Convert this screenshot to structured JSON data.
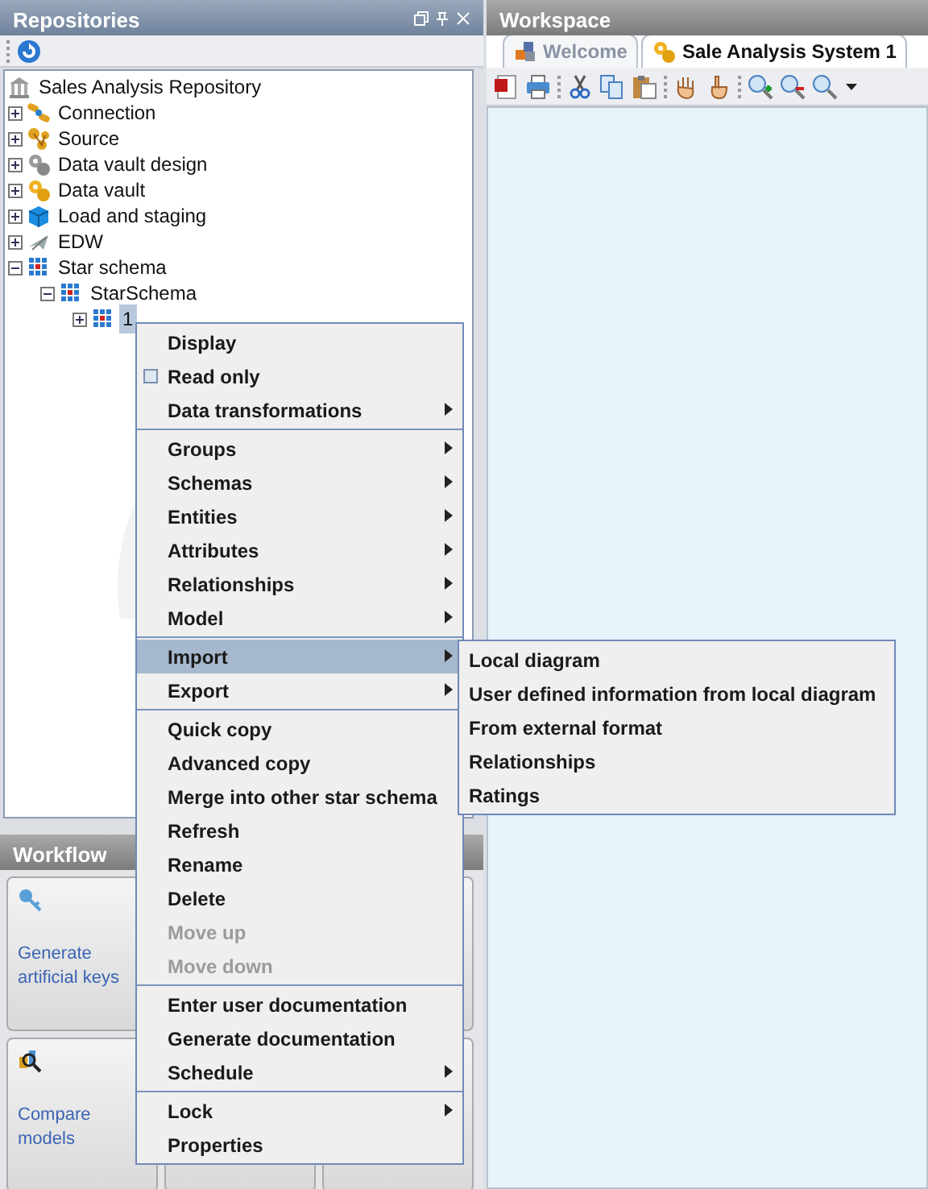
{
  "repositories": {
    "title": "Repositories",
    "tree": [
      {
        "label": "Sales Analysis Repository",
        "kind": "repository",
        "selected": false,
        "children": [
          {
            "label": "Connection",
            "kind": "connection",
            "expanded": false,
            "selected": false
          },
          {
            "label": "Source",
            "kind": "source",
            "expanded": false,
            "selected": false
          },
          {
            "label": "Data vault design",
            "kind": "gears-grey",
            "expanded": false,
            "selected": false
          },
          {
            "label": "Data vault",
            "kind": "gears",
            "expanded": false,
            "selected": false
          },
          {
            "label": "Load and staging",
            "kind": "cube",
            "expanded": false,
            "selected": false
          },
          {
            "label": "EDW",
            "kind": "plane",
            "expanded": false,
            "selected": false
          },
          {
            "label": "Star schema",
            "kind": "grid",
            "expanded": true,
            "selected": false,
            "children": [
              {
                "label": "StarSchema",
                "kind": "grid",
                "expanded": true,
                "selected": false,
                "children": [
                  {
                    "label": "1",
                    "kind": "grid",
                    "expanded": false,
                    "selected": true
                  }
                ]
              }
            ]
          }
        ]
      }
    ]
  },
  "workflow": {
    "title": "Workflow",
    "cards": [
      {
        "label": "Generate artificial keys",
        "kind": "key"
      },
      {
        "kind": "blank"
      },
      {
        "label": "Compare models",
        "kind": "compare"
      },
      {
        "kind": "blank"
      },
      {
        "kind": "blank"
      }
    ]
  },
  "workspace": {
    "title": "Workspace",
    "tabs": [
      {
        "label": "Welcome",
        "kind": "welcome",
        "selected": false
      },
      {
        "label": "Sale Analysis System 1",
        "kind": "gears",
        "selected": true
      }
    ],
    "toolbar": [
      {
        "items": [
          {
            "kind": "pdf"
          },
          {
            "kind": "print"
          }
        ]
      },
      {
        "items": [
          {
            "kind": "cut"
          },
          {
            "kind": "copy"
          },
          {
            "kind": "paste"
          }
        ]
      },
      {
        "items": [
          {
            "kind": "hand"
          },
          {
            "kind": "pointer"
          }
        ]
      },
      {
        "items": [
          {
            "kind": "zoom-in"
          },
          {
            "kind": "zoom-out"
          },
          {
            "kind": "zoom"
          },
          {
            "kind": "caret"
          }
        ]
      }
    ]
  },
  "context_menu": {
    "groups": [
      [
        {
          "label": "Display",
          "selected": false,
          "disabled": false,
          "submenu": false
        },
        {
          "label": "Read only",
          "kind": "checkbox",
          "checked": false,
          "selected": false,
          "disabled": false,
          "submenu": false
        },
        {
          "label": "Data transformations",
          "selected": false,
          "disabled": false,
          "submenu": true
        }
      ],
      [
        {
          "label": "Groups",
          "selected": false,
          "disabled": false,
          "submenu": true
        },
        {
          "label": "Schemas",
          "selected": false,
          "disabled": false,
          "submenu": true
        },
        {
          "label": "Entities",
          "selected": false,
          "disabled": false,
          "submenu": true
        },
        {
          "label": "Attributes",
          "selected": false,
          "disabled": false,
          "submenu": true
        },
        {
          "label": "Relationships",
          "selected": false,
          "disabled": false,
          "submenu": true
        },
        {
          "label": "Model",
          "selected": false,
          "disabled": false,
          "submenu": true
        }
      ],
      [
        {
          "label": "Import",
          "selected": true,
          "disabled": false,
          "submenu": true
        },
        {
          "label": "Export",
          "selected": false,
          "disabled": false,
          "submenu": true
        }
      ],
      [
        {
          "label": "Quick copy",
          "selected": false,
          "disabled": false,
          "submenu": false
        },
        {
          "label": "Advanced copy",
          "selected": false,
          "disabled": false,
          "submenu": false
        },
        {
          "label": "Merge into other star schema",
          "selected": false,
          "disabled": false,
          "submenu": false
        },
        {
          "label": "Refresh",
          "selected": false,
          "disabled": false,
          "submenu": false
        },
        {
          "label": "Rename",
          "selected": false,
          "disabled": false,
          "submenu": false
        },
        {
          "label": "Delete",
          "selected": false,
          "disabled": false,
          "submenu": false
        },
        {
          "label": "Move up",
          "selected": false,
          "disabled": true,
          "submenu": false
        },
        {
          "label": "Move down",
          "selected": false,
          "disabled": true,
          "submenu": false
        }
      ],
      [
        {
          "label": "Enter user documentation",
          "selected": false,
          "disabled": false,
          "submenu": false
        },
        {
          "label": "Generate documentation",
          "selected": false,
          "disabled": false,
          "submenu": false
        },
        {
          "label": "Schedule",
          "selected": false,
          "disabled": false,
          "submenu": true
        }
      ],
      [
        {
          "label": "Lock",
          "selected": false,
          "disabled": false,
          "submenu": true
        },
        {
          "label": "Properties",
          "selected": false,
          "disabled": false,
          "submenu": false
        }
      ]
    ]
  },
  "import_submenu": [
    {
      "label": "Local diagram",
      "selected": false
    },
    {
      "label": "User defined information from local diagram",
      "selected": false
    },
    {
      "label": "From external format",
      "selected": false
    },
    {
      "label": "Relationships",
      "selected": false
    },
    {
      "label": "Ratings",
      "selected": false
    }
  ]
}
